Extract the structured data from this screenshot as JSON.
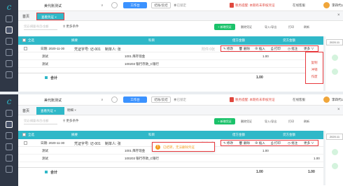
{
  "app": {
    "company": "美代账测试",
    "work_btn": "工作台",
    "period_btn": "结账/反结",
    "locked": "◉已锁定",
    "warning": "税务提醒: 本期有未审核凭证",
    "support": "在线客服",
    "user": "李四代1"
  },
  "tabs": {
    "home": "首页",
    "active": "查看凭证 ×",
    "second": "明细 ×"
  },
  "toolbar": {
    "search_placeholder": "凭证/摘要/科目/金额",
    "more_conditions": "更多条件",
    "new_voucher": "+ 新增凭证",
    "batch_delete": "删除凭证",
    "import_export": "导入/导出",
    "print": "打印",
    "refresh": "刷新"
  },
  "table": {
    "headers": [
      "全选",
      "摘要",
      "科目",
      "借方金额",
      "贷方金额"
    ],
    "voucher_date": "日期: 2020-11-30",
    "voucher_no": "凭证字号: 记-001",
    "preparer": "制单人: 张",
    "attachments": "附件:0张",
    "rows": [
      {
        "desc": "测试",
        "account": "1001 库存现金",
        "debit": "1.00",
        "credit": ""
      },
      {
        "desc": "测试",
        "account": "100203 银行存款_C银行",
        "debit": "",
        "credit": "1.00"
      }
    ],
    "total_label": "合计",
    "total_debit": "1.00",
    "total_credit": "1.00"
  },
  "row_ops": {
    "edit": "✎ 修改",
    "delete": "🗑 删除",
    "insert": "⊕ 插入",
    "print": "⎙ 打印",
    "approve": "◷ 批注",
    "more": "更多 ∨"
  },
  "more_menu": [
    "复制",
    "冲销",
    "作废"
  ],
  "side_date": "2020.11",
  "toast": "已结转，无法删除凭证",
  "colors": {
    "teal": "#2fb8c8",
    "highlight": "#e8383d",
    "new_btn": "#1bc26a",
    "sidebar": "#2f3746"
  }
}
